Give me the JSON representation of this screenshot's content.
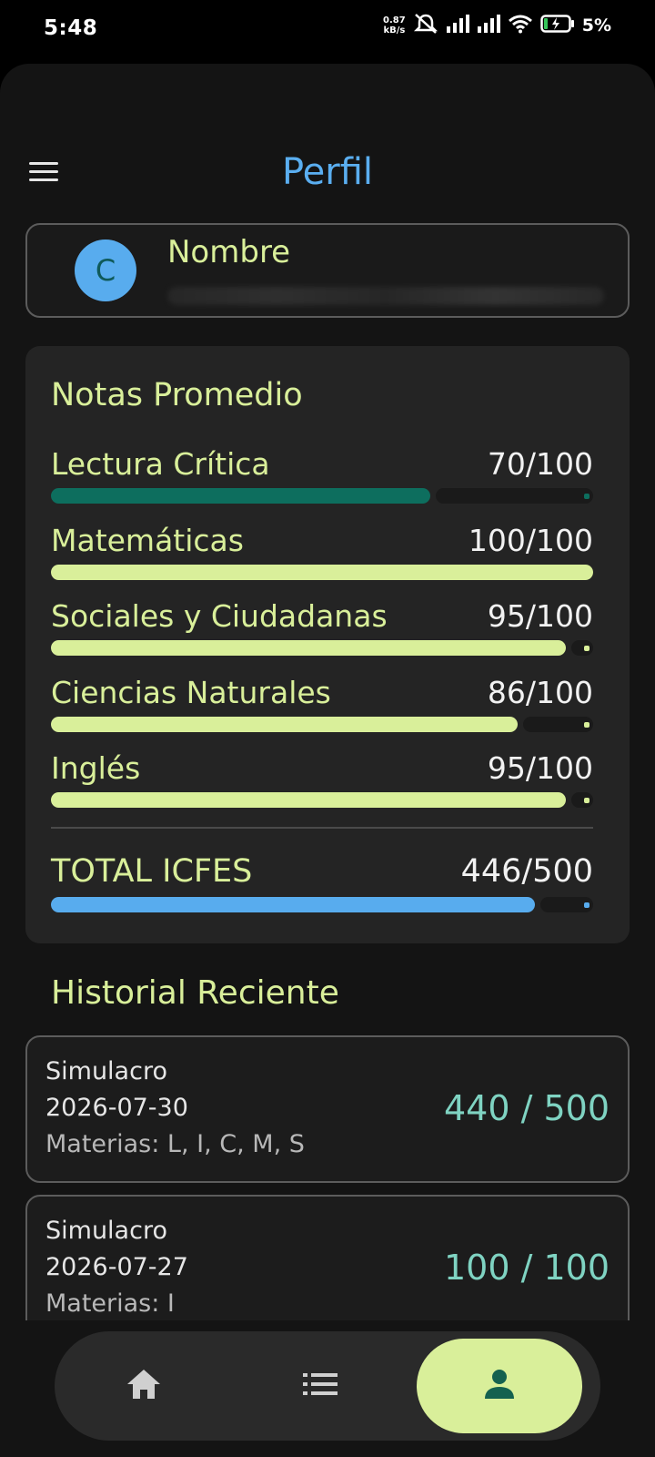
{
  "status_bar": {
    "time": "5:48",
    "net_speed_value": "0.87",
    "net_speed_unit": "kB/s",
    "battery": "5%"
  },
  "header": {
    "title": "Perfil"
  },
  "user": {
    "avatar_initial": "C",
    "name_label": "Nombre"
  },
  "grades": {
    "title": "Notas Promedio",
    "subjects": [
      {
        "label": "Lectura Crítica",
        "score": "70/100",
        "value": 70,
        "color": "#0d6e5e"
      },
      {
        "label": "Matemáticas",
        "score": "100/100",
        "value": 100,
        "color": "#d9ef9a"
      },
      {
        "label": "Sociales y Ciudadanas",
        "score": "95/100",
        "value": 95,
        "color": "#d9ef9a"
      },
      {
        "label": "Ciencias Naturales",
        "score": "86/100",
        "value": 86,
        "color": "#d9ef9a"
      },
      {
        "label": "Inglés",
        "score": "95/100",
        "value": 95,
        "color": "#d9ef9a"
      }
    ],
    "total": {
      "label": "TOTAL ICFES",
      "score": "446/500",
      "value": 446,
      "max": 500,
      "color": "#58acee"
    }
  },
  "history": {
    "title": "Historial Reciente",
    "items": [
      {
        "type": "Simulacro",
        "date": "2026-07-30",
        "subjects": "Materias: L, I, C, M, S",
        "score": "440 / 500"
      },
      {
        "type": "Simulacro",
        "date": "2026-07-27",
        "subjects": "Materias: I",
        "score": "100 / 100"
      }
    ]
  },
  "nav": {
    "items": [
      {
        "icon": "home-icon",
        "active": false
      },
      {
        "icon": "list-icon",
        "active": false
      },
      {
        "icon": "person-icon",
        "active": true
      }
    ]
  },
  "colors": {
    "accent": "#d9ef9a",
    "title_blue": "#5aaef0",
    "score_teal": "#7fd3c2"
  }
}
